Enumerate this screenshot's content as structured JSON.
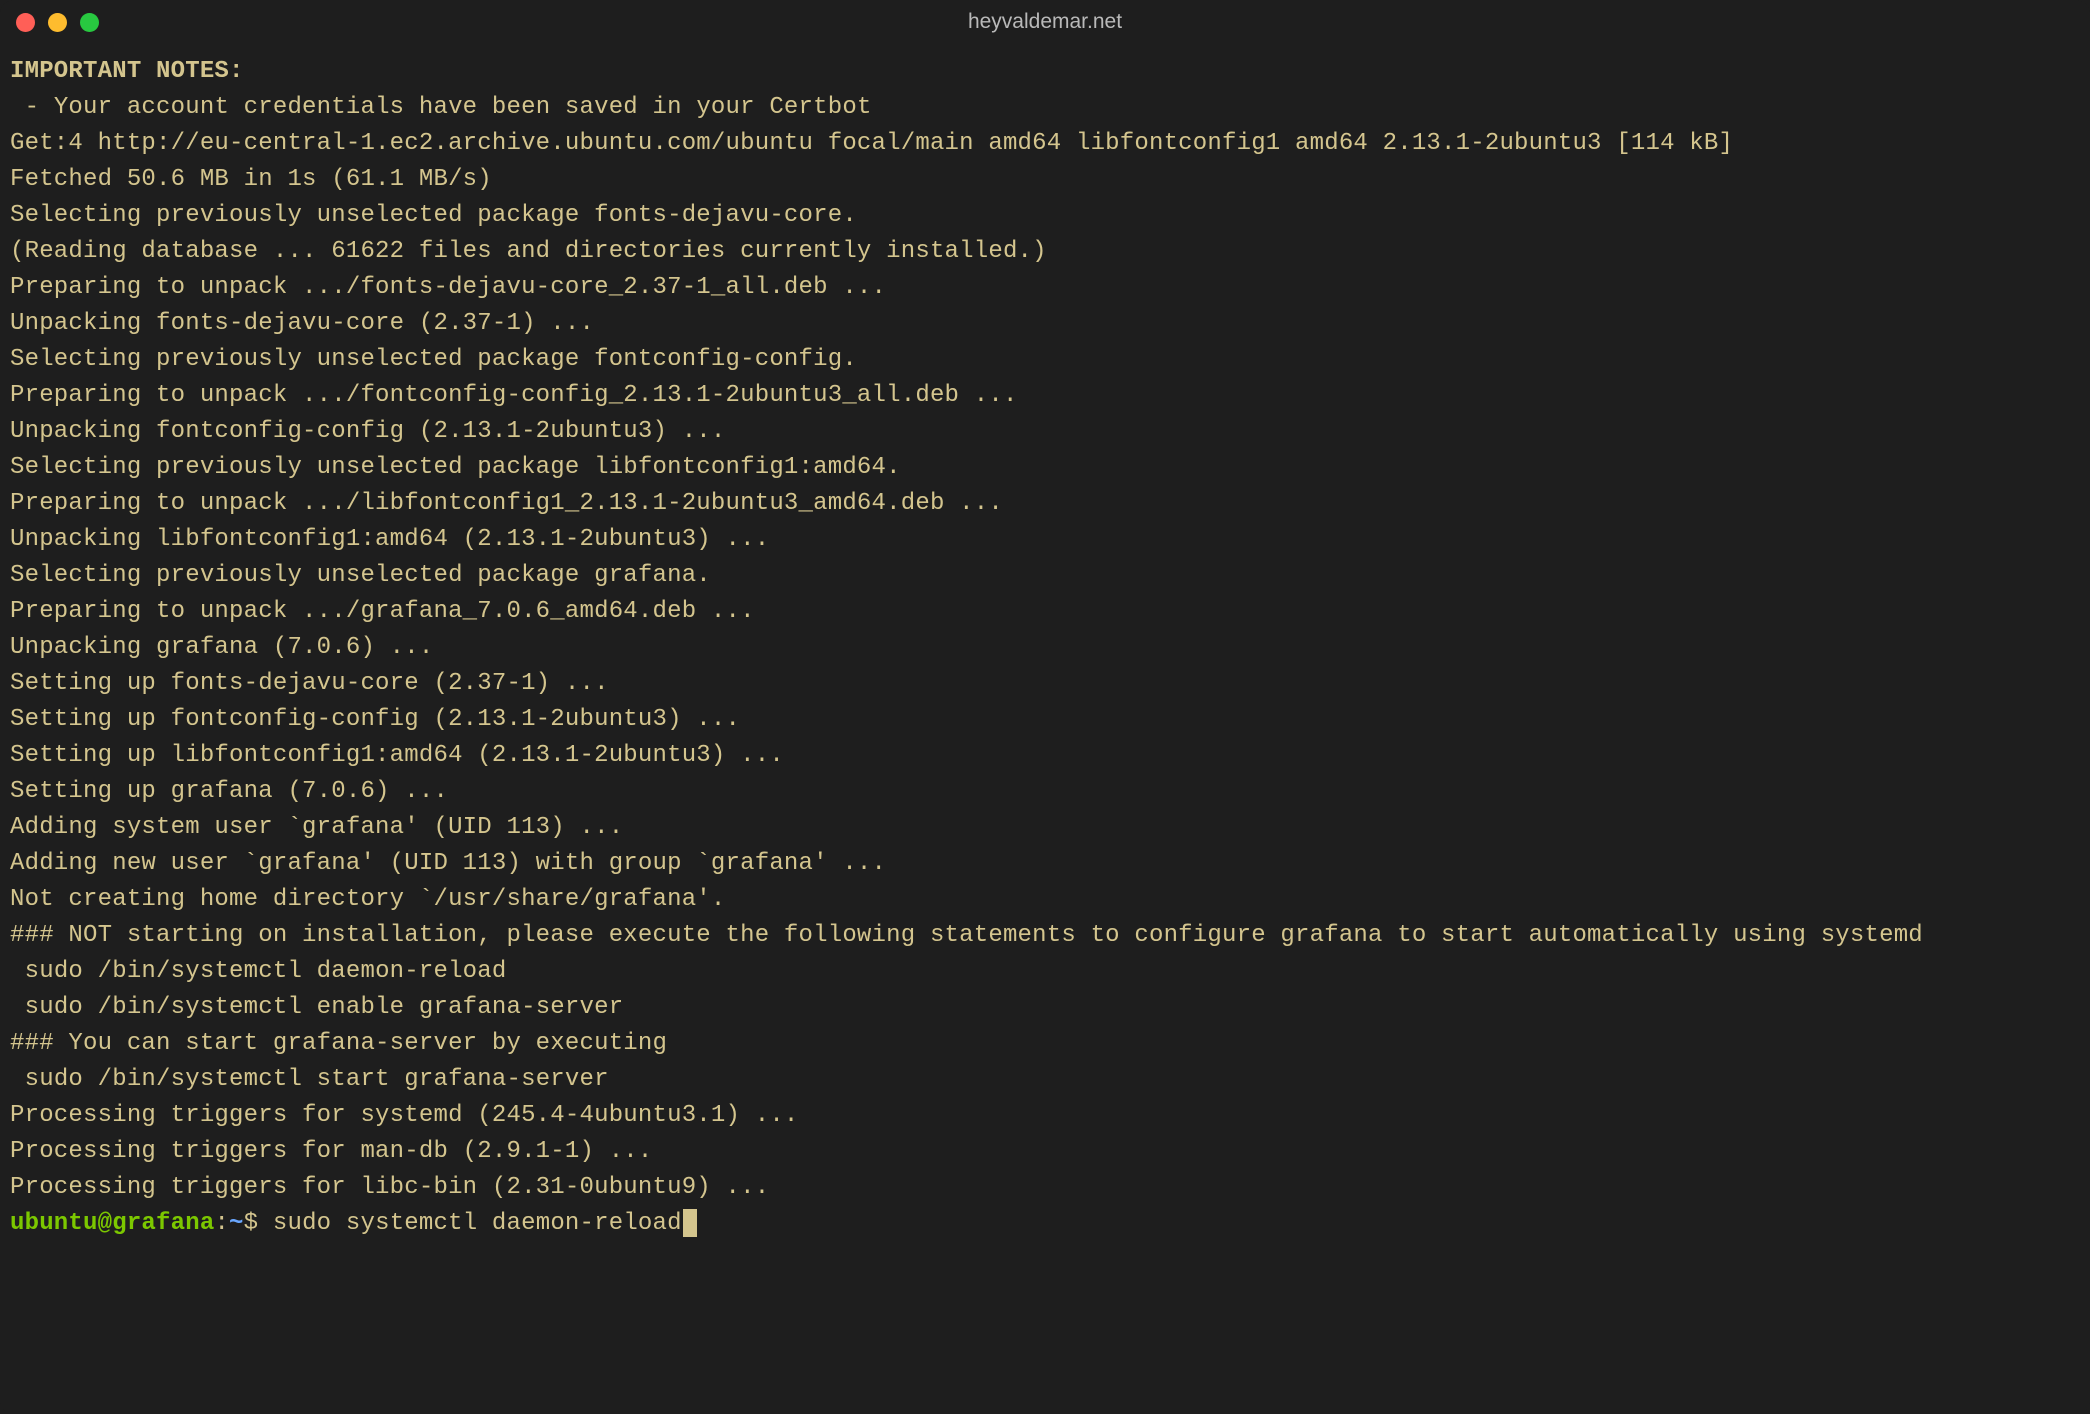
{
  "window": {
    "title": "heyvaldemar.net"
  },
  "terminal": {
    "lines": [
      "IMPORTANT NOTES:",
      " - Your account credentials have been saved in your Certbot",
      "Get:4 http://eu-central-1.ec2.archive.ubuntu.com/ubuntu focal/main amd64 libfontconfig1 amd64 2.13.1-2ubuntu3 [114 kB]",
      "Fetched 50.6 MB in 1s (61.1 MB/s)",
      "Selecting previously unselected package fonts-dejavu-core.",
      "(Reading database ... 61622 files and directories currently installed.)",
      "Preparing to unpack .../fonts-dejavu-core_2.37-1_all.deb ...",
      "Unpacking fonts-dejavu-core (2.37-1) ...",
      "Selecting previously unselected package fontconfig-config.",
      "Preparing to unpack .../fontconfig-config_2.13.1-2ubuntu3_all.deb ...",
      "Unpacking fontconfig-config (2.13.1-2ubuntu3) ...",
      "Selecting previously unselected package libfontconfig1:amd64.",
      "Preparing to unpack .../libfontconfig1_2.13.1-2ubuntu3_amd64.deb ...",
      "Unpacking libfontconfig1:amd64 (2.13.1-2ubuntu3) ...",
      "Selecting previously unselected package grafana.",
      "Preparing to unpack .../grafana_7.0.6_amd64.deb ...",
      "Unpacking grafana (7.0.6) ...",
      "Setting up fonts-dejavu-core (2.37-1) ...",
      "Setting up fontconfig-config (2.13.1-2ubuntu3) ...",
      "Setting up libfontconfig1:amd64 (2.13.1-2ubuntu3) ...",
      "Setting up grafana (7.0.6) ...",
      "Adding system user `grafana' (UID 113) ...",
      "Adding new user `grafana' (UID 113) with group `grafana' ...",
      "Not creating home directory `/usr/share/grafana'.",
      "### NOT starting on installation, please execute the following statements to configure grafana to start automatically using systemd",
      " sudo /bin/systemctl daemon-reload",
      " sudo /bin/systemctl enable grafana-server",
      "### You can start grafana-server by executing",
      " sudo /bin/systemctl start grafana-server",
      "Processing triggers for systemd (245.4-4ubuntu3.1) ...",
      "Processing triggers for man-db (2.9.1-1) ...",
      "Processing triggers for libc-bin (2.31-0ubuntu9) ..."
    ],
    "bold_line_count": 1,
    "prompt": {
      "user_host": "ubuntu@grafana",
      "separator": ":",
      "path": "~",
      "dollar": "$ ",
      "command": "sudo systemctl daemon-reload"
    }
  }
}
